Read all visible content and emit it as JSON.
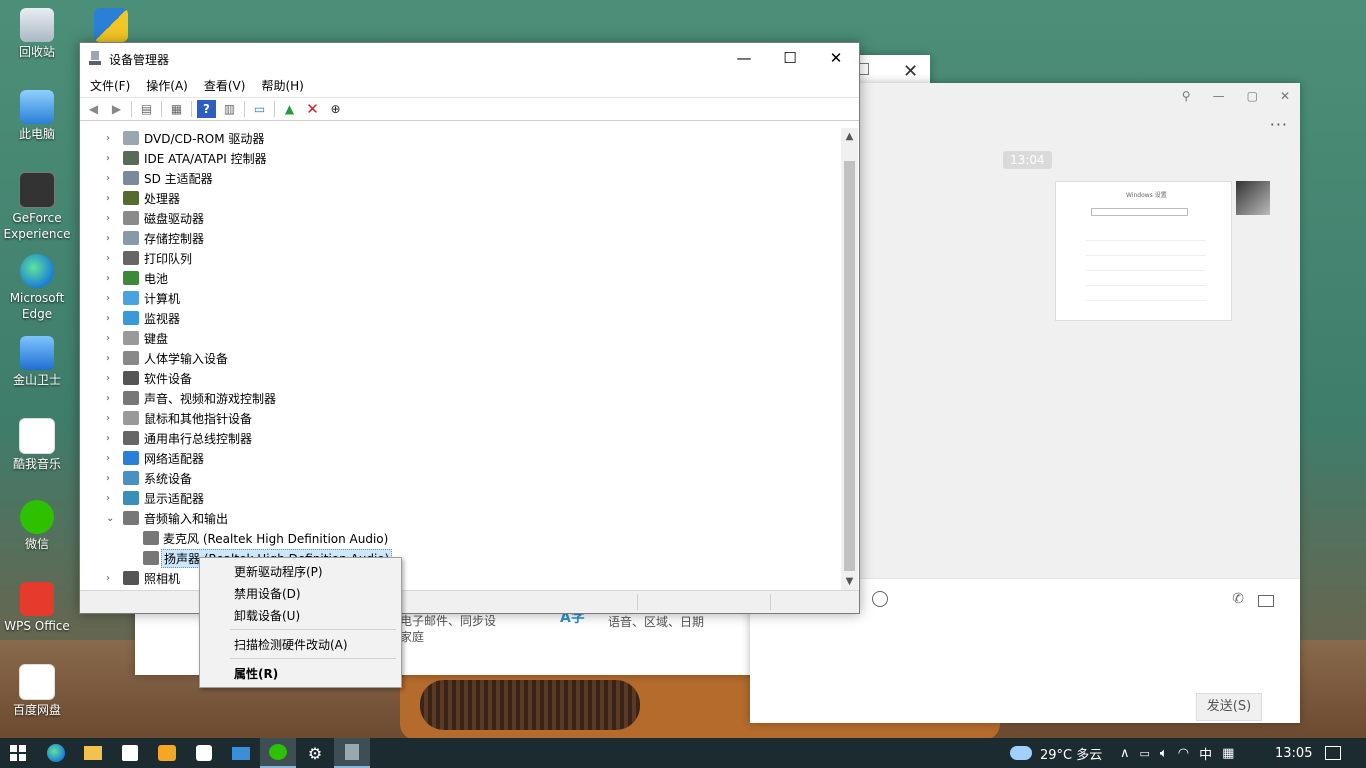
{
  "desktop": {
    "icons": [
      {
        "label": "回收站"
      },
      {
        "label": ""
      },
      {
        "label": "此电脑"
      },
      {
        "label": "GeForce Experience"
      },
      {
        "label": "Microsoft Edge"
      },
      {
        "label": "金山卫士"
      },
      {
        "label": "酷我音乐"
      },
      {
        "label": "微信"
      },
      {
        "label": "WPS Office"
      },
      {
        "label": "百度网盘"
      }
    ]
  },
  "settings_bg": {
    "line1": "电子邮件、同步设",
    "line1b": "家庭",
    "line2": "语音、区域、日期",
    "glyph": "A字"
  },
  "wechat": {
    "time": "13:04",
    "thumb_title": "Windows 设置",
    "send": "发送(S)",
    "more": "···"
  },
  "devmgr": {
    "title": "设备管理器",
    "menu": [
      "文件(F)",
      "操作(A)",
      "查看(V)",
      "帮助(H)"
    ],
    "tree": [
      {
        "label": "DVD/CD-ROM 驱动器",
        "icon": "dvd-icon"
      },
      {
        "label": "IDE ATA/ATAPI 控制器",
        "icon": "ide-icon"
      },
      {
        "label": "SD 主适配器",
        "icon": "sd-icon"
      },
      {
        "label": "处理器",
        "icon": "cpu-icon"
      },
      {
        "label": "磁盘驱动器",
        "icon": "disk-icon"
      },
      {
        "label": "存储控制器",
        "icon": "storage-icon"
      },
      {
        "label": "打印队列",
        "icon": "printer-icon"
      },
      {
        "label": "电池",
        "icon": "battery-icon"
      },
      {
        "label": "计算机",
        "icon": "computer-icon"
      },
      {
        "label": "监视器",
        "icon": "monitor-icon"
      },
      {
        "label": "键盘",
        "icon": "keyboard-icon"
      },
      {
        "label": "人体学输入设备",
        "icon": "hid-icon"
      },
      {
        "label": "软件设备",
        "icon": "software-device-icon"
      },
      {
        "label": "声音、视频和游戏控制器",
        "icon": "sound-icon"
      },
      {
        "label": "鼠标和其他指针设备",
        "icon": "mouse-icon"
      },
      {
        "label": "通用串行总线控制器",
        "icon": "usb-icon"
      },
      {
        "label": "网络适配器",
        "icon": "network-icon"
      },
      {
        "label": "系统设备",
        "icon": "system-icon"
      },
      {
        "label": "显示适配器",
        "icon": "display-icon"
      },
      {
        "label": "音频输入和输出",
        "icon": "audio-icon",
        "expanded": true
      },
      {
        "label": "麦克风 (Realtek High Definition Audio)",
        "icon": "microphone-icon",
        "child": true
      },
      {
        "label": "扬声器 (Realtek High Definition Audio)",
        "icon": "speaker-icon",
        "child": true,
        "selected": true
      },
      {
        "label": "照相机",
        "icon": "camera-icon"
      }
    ]
  },
  "context_menu": {
    "update": "更新驱动程序(P)",
    "disable": "禁用设备(D)",
    "uninstall": "卸载设备(U)",
    "scan": "扫描检测硬件改动(A)",
    "properties": "属性(R)"
  },
  "taskbar": {
    "weather": "29°C 多云",
    "ime": "中",
    "time": "13:05"
  },
  "colors": {
    "selection": "#cce8ff",
    "taskbar": "#1c2b30"
  }
}
